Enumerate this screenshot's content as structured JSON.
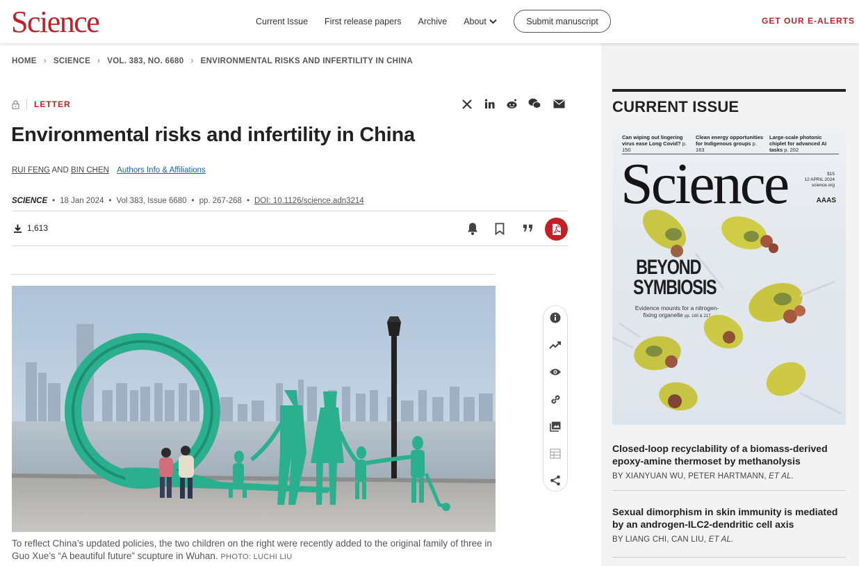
{
  "header": {
    "logo": "Science",
    "nav": [
      "Current Issue",
      "First release papers",
      "Archive",
      "About"
    ],
    "submit_label": "Submit manuscript",
    "ealerts_label": "GET OUR E-ALERTS"
  },
  "breadcrumb": [
    "HOME",
    "SCIENCE",
    "VOL. 383, NO. 6680",
    "ENVIRONMENTAL RISKS AND INFERTILITY IN CHINA"
  ],
  "article": {
    "type": "LETTER",
    "title": "Environmental risks and infertility in China",
    "authors": [
      "RUI FENG",
      "BIN CHEN"
    ],
    "authors_joiner": "AND",
    "affiliations_link": "Authors Info & Affiliations",
    "journal": "SCIENCE",
    "date": "18 Jan 2024",
    "volume": "Vol 383, Issue 6680",
    "pages": "pp. 267-268",
    "doi": "DOI: 10.1126/science.adn3214",
    "downloads": "1,613",
    "caption": "To reflect China’s updated policies, the two children on the right were recently added to the original family of three in Guo Xue’s “A beautiful future” scupture in Wuhan.",
    "photo_credit": "PHOTO: LUCHI LIU"
  },
  "share_icons": [
    "x-icon",
    "linkedin-icon",
    "reddit-icon",
    "wechat-icon",
    "email-icon"
  ],
  "tool_icons": [
    "bell-icon",
    "bookmark-icon",
    "quote-icon",
    "pdf-icon"
  ],
  "float_icons": [
    "info-icon",
    "trend-icon",
    "eye-icon",
    "link-icon",
    "image-icon",
    "table-icon",
    "share-icon"
  ],
  "sidebar": {
    "heading": "CURRENT ISSUE",
    "cover": {
      "teasers": [
        "Can wiping out lingering virus ease Long Covid?",
        "Clean energy opportunities for Indigenous groups",
        "Large-scale photonic chiplet for advanced AI tasks"
      ],
      "teaser_pages": [
        "p. 150",
        "p. 163",
        "p. 202"
      ],
      "logo": "Science",
      "price": "$15",
      "issue_date": "12 APRIL 2024",
      "site": "science.org",
      "aaas": "AAAS",
      "headline_1": "BEYOND",
      "headline_2": "SYMBIOSIS",
      "subhead": "Evidence mounts for a nitrogen-fixing organelle",
      "subhead_pages": "pp. 160 & 217"
    },
    "items": [
      {
        "title": "Closed-loop recyclability of a biomass-derived epoxy-amine thermoset by methanolysis",
        "authors": "BY XIANYUAN WU,  PETER HARTMANN,",
        "etal": "ET AL."
      },
      {
        "title": "Sexual dimorphism in skin immunity is mediated by an androgen-ILC2-dendritic cell axis",
        "authors": "BY LIANG CHI,  CAN LIU,",
        "etal": "ET AL."
      }
    ]
  },
  "colors": {
    "brand_red": "#c41f24",
    "sidebar_bg": "#f3f3f3",
    "link_blue": "#1a5fb4",
    "sculpture_teal": "#2bb08f"
  }
}
